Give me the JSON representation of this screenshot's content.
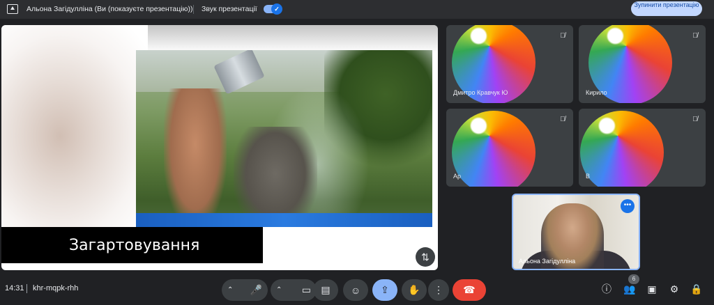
{
  "topbar": {
    "presenter_text": "Альона Загідулліна (Ви (показуєте презентацію))",
    "sound_label": "Звук презентації",
    "sound_enabled": true,
    "stop_button": "Зупинити презентацію"
  },
  "slide": {
    "caption": "Загартовування"
  },
  "participants": [
    {
      "name": "Дмитро Кравчук Ю"
    },
    {
      "name": "Кирило"
    },
    {
      "name": "Ар"
    },
    {
      "name": "В"
    }
  ],
  "self_view": {
    "name": "Альона Загідулліна"
  },
  "bottombar": {
    "time": "14:31",
    "meeting_code": "khr-mqpk-rhh",
    "participants_count": "6"
  },
  "colors": {
    "accent": "#8ab4f8",
    "end_call": "#ea4335",
    "stop_button_bg": "#c2d7ff"
  }
}
